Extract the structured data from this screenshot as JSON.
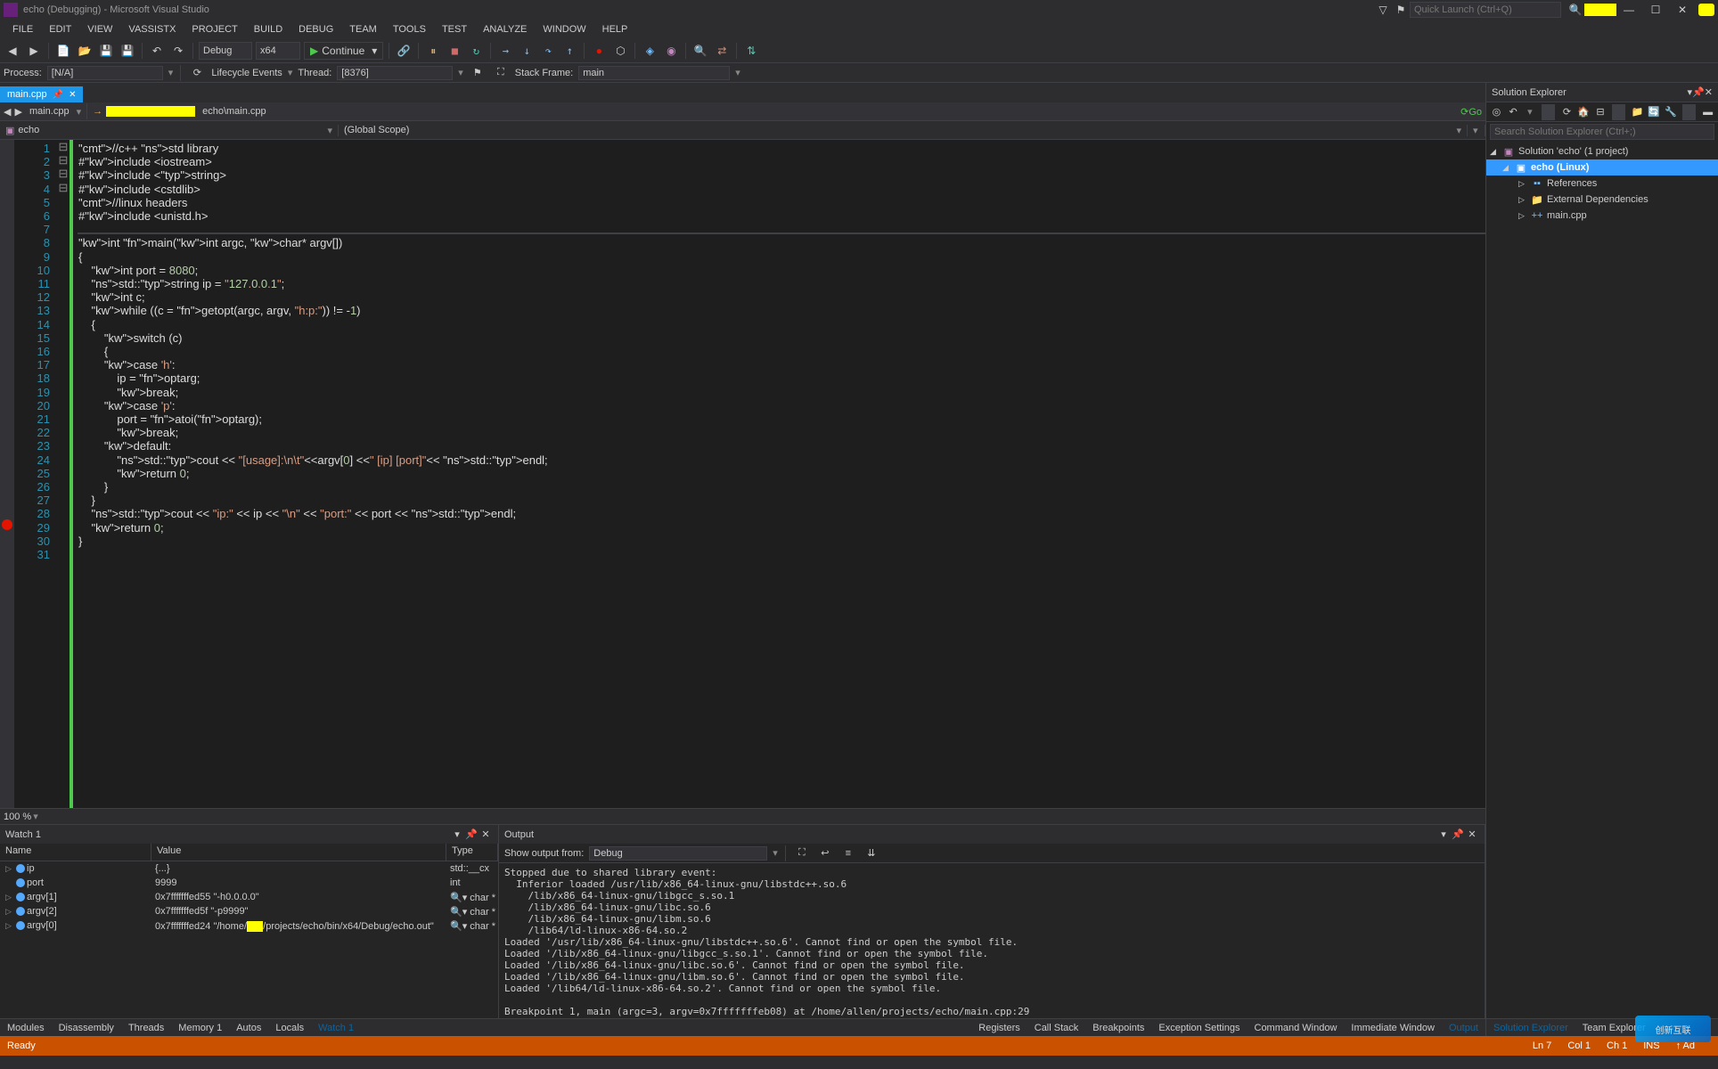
{
  "title": "echo (Debugging) - Microsoft Visual Studio",
  "quick_launch_placeholder": "Quick Launch (Ctrl+Q)",
  "menu": [
    "FILE",
    "EDIT",
    "VIEW",
    "VASSISTX",
    "PROJECT",
    "BUILD",
    "DEBUG",
    "TEAM",
    "TOOLS",
    "TEST",
    "ANALYZE",
    "WINDOW",
    "HELP"
  ],
  "toolbar1": {
    "config": "Debug",
    "platform": "x64",
    "continue": "Continue"
  },
  "toolbar2": {
    "process_lbl": "Process:",
    "process": "[N/A]",
    "lifecycle": "Lifecycle Events",
    "thread_lbl": "Thread:",
    "thread": "[8376]",
    "stackframe_lbl": "Stack Frame:",
    "stackframe": "main"
  },
  "tab": {
    "name": "main.cpp",
    "pinned": true
  },
  "pathbar": {
    "file": "main.cpp",
    "suffix": "echo\\main.cpp",
    "go": "Go"
  },
  "navdd": {
    "project": "echo",
    "scope": "(Global Scope)"
  },
  "code_lines": [
    "//c++ std library",
    "#include <iostream>",
    "#include <string>",
    "#include <cstdlib>",
    "//linux headers",
    "#include <unistd.h>",
    "",
    "int main(int argc, char* argv[])",
    "{",
    "    int port = 8080;",
    "    std::string ip = \"127.0.0.1\";",
    "    int c;",
    "    while ((c = getopt(argc, argv, \"h:p:\")) != -1)",
    "    {",
    "        switch (c)",
    "        {",
    "        case 'h':",
    "            ip = optarg;",
    "            break;",
    "        case 'p':",
    "            port = atoi(optarg);",
    "            break;",
    "        default:",
    "            std::cout << \"[usage]:\\n\\t\"<<argv[0] <<\" [ip] [port]\"<< std::endl;",
    "            return 0;",
    "        }",
    "    }",
    "    std::cout << \"ip:\" << ip << \"\\n\" << \"port:\" << port << std::endl;",
    "    return 0;",
    "}",
    ""
  ],
  "breakpoint_line": 29,
  "active_line": 7,
  "zoom": "100 %",
  "watch": {
    "title": "Watch 1",
    "cols": [
      "Name",
      "Value",
      "Type"
    ],
    "rows": [
      {
        "name": "ip",
        "value": "{...}",
        "type": "std::__cx",
        "expandable": true
      },
      {
        "name": "port",
        "value": "9999",
        "type": "int",
        "expandable": false
      },
      {
        "name": "argv[1]",
        "value": "0x7fffffffed55 \"-h0.0.0.0\"",
        "type": "char *",
        "expandable": true,
        "search": true
      },
      {
        "name": "argv[2]",
        "value": "0x7fffffffed5f \"-p9999\"",
        "type": "char *",
        "expandable": true,
        "search": true
      },
      {
        "name": "argv[0]",
        "value": "0x7fffffffed24 \"/home/▮▮▮/projects/echo/bin/x64/Debug/echo.out\"",
        "type": "char *",
        "expandable": true,
        "search": true
      }
    ]
  },
  "output": {
    "title": "Output",
    "from_lbl": "Show output from:",
    "from": "Debug",
    "text": "Stopped due to shared library event:\n  Inferior loaded /usr/lib/x86_64-linux-gnu/libstdc++.so.6\n    /lib/x86_64-linux-gnu/libgcc_s.so.1\n    /lib/x86_64-linux-gnu/libc.so.6\n    /lib/x86_64-linux-gnu/libm.so.6\n    /lib64/ld-linux-x86-64.so.2\nLoaded '/usr/lib/x86_64-linux-gnu/libstdc++.so.6'. Cannot find or open the symbol file.\nLoaded '/lib/x86_64-linux-gnu/libgcc_s.so.1'. Cannot find or open the symbol file.\nLoaded '/lib/x86_64-linux-gnu/libc.so.6'. Cannot find or open the symbol file.\nLoaded '/lib/x86_64-linux-gnu/libm.so.6'. Cannot find or open the symbol file.\nLoaded '/lib64/ld-linux-x86-64.so.2'. Cannot find or open the symbol file.\n\nBreakpoint 1, main (argc=3, argv=0x7fffffffeb08) at /home/allen/projects/echo/main.cpp:29"
  },
  "bottom_tabs_left": [
    "Modules",
    "Disassembly",
    "Threads",
    "Memory 1",
    "Autos",
    "Locals",
    "Watch 1"
  ],
  "bottom_tabs_right": [
    "Registers",
    "Call Stack",
    "Breakpoints",
    "Exception Settings",
    "Command Window",
    "Immediate Window",
    "Output"
  ],
  "solution_explorer": {
    "title": "Solution Explorer",
    "search_placeholder": "Search Solution Explorer (Ctrl+;)",
    "solution": "Solution 'echo' (1 project)",
    "project": "echo (Linux)",
    "refs": "References",
    "extdeps": "External Dependencies",
    "file": "main.cpp",
    "tabs": [
      "Solution Explorer",
      "Team Explorer"
    ]
  },
  "status": {
    "ready": "Ready",
    "ln": "Ln 7",
    "col": "Col 1",
    "ch": "Ch 1",
    "ins": "INS",
    "add": "↑ Ad"
  }
}
